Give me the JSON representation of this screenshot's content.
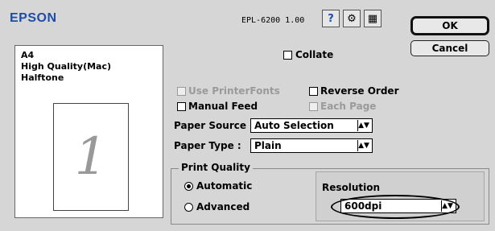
{
  "header": {
    "logo": "EPSON",
    "model": "EPL-6200  1.00",
    "icons": [
      "help-icon",
      "printer-settings-icon",
      "layout-icon"
    ],
    "help_glyph": "?",
    "settings_glyph": "⚙",
    "layout_glyph": "▦"
  },
  "buttons": {
    "ok": "OK",
    "cancel": "Cancel"
  },
  "preview": {
    "lines": [
      "A4",
      "High Quality(Mac)",
      "Halftone"
    ],
    "page_number": "1"
  },
  "options": {
    "collate": "Collate",
    "use_printer_fonts": "Use PrinterFonts",
    "reverse_order": "Reverse Order",
    "manual_feed": "Manual Feed",
    "each_page": "Each Page"
  },
  "paper_source": {
    "label": "Paper Source :",
    "value": "Auto Selection"
  },
  "paper_type": {
    "label": "Paper Type :",
    "value": "Plain"
  },
  "print_quality": {
    "title": "Print Quality",
    "automatic": "Automatic",
    "advanced": "Advanced",
    "selected": "Automatic"
  },
  "resolution": {
    "label": "Resolution",
    "value": "600dpi"
  },
  "colors": {
    "logo": "#1d4da8",
    "background": "#d6d6d6",
    "disabled_text": "#9a9a9a"
  }
}
